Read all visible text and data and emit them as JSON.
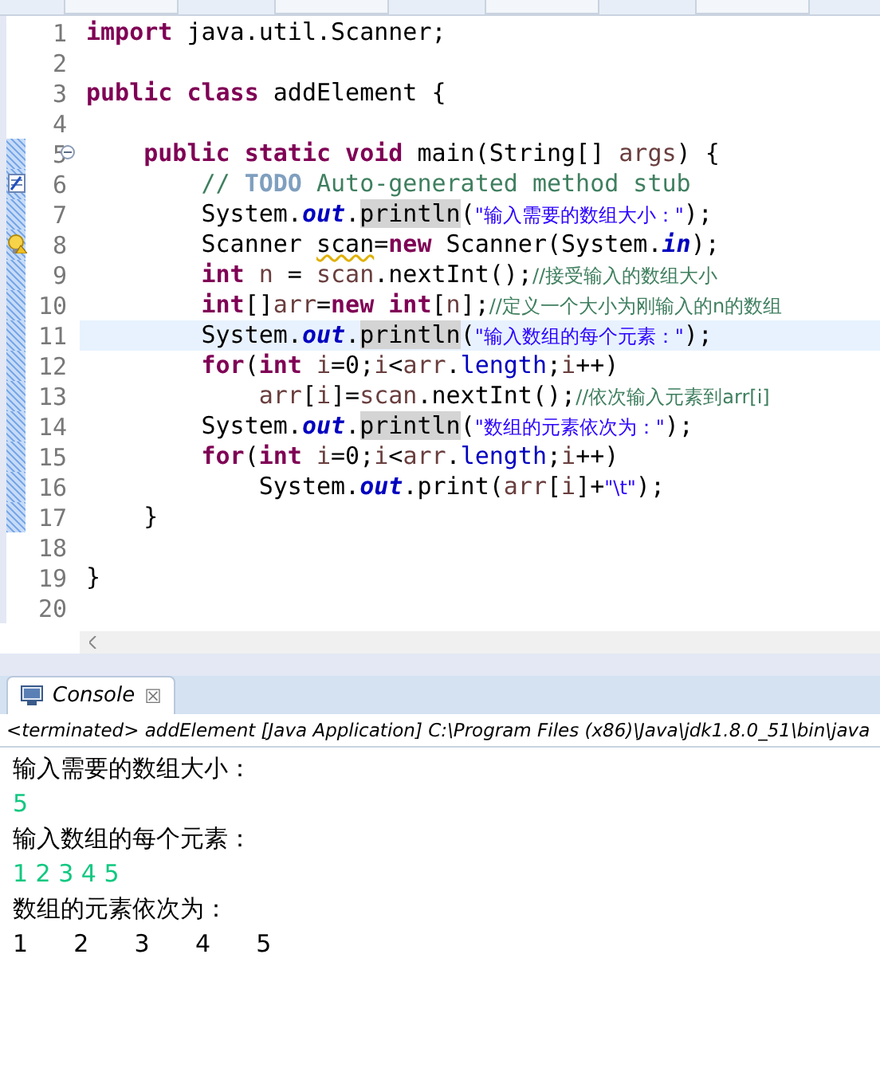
{
  "editor": {
    "lines": [
      {
        "number": "1",
        "changed": false,
        "current": false,
        "tokens": [
          {
            "kind": "kw",
            "text": "import"
          },
          {
            "kind": "plain",
            "text": " java.util.Scanner;"
          }
        ]
      },
      {
        "number": "2",
        "changed": false,
        "current": false
      },
      {
        "number": "3",
        "changed": false,
        "current": false,
        "tokens": [
          {
            "kind": "kw",
            "text": "public class"
          },
          {
            "kind": "plain",
            "text": " addElement {"
          }
        ]
      },
      {
        "number": "4",
        "changed": false,
        "current": false
      },
      {
        "number": "5",
        "changed": true,
        "current": false,
        "collapsible": true,
        "tokens": [
          {
            "kind": "kw",
            "text": "    public static void"
          },
          {
            "kind": "plain",
            "text": " main(String[] "
          },
          {
            "kind": "var",
            "text": "args"
          },
          {
            "kind": "plain",
            "text": ") {"
          }
        ]
      },
      {
        "number": "6",
        "changed": true,
        "current": false,
        "task": true,
        "tokens": [
          {
            "kind": "comment",
            "text": "        // "
          },
          {
            "kind": "todo",
            "text": "TODO"
          },
          {
            "kind": "comment",
            "text": " Auto-generated method stub"
          }
        ]
      },
      {
        "number": "7",
        "changed": true,
        "current": false,
        "tokens": [
          {
            "kind": "plain",
            "text": "        System."
          },
          {
            "kind": "field",
            "text": "out"
          },
          {
            "kind": "plain",
            "text": "."
          },
          {
            "kind": "occurrence",
            "text": "println"
          },
          {
            "kind": "plain",
            "text": "("
          },
          {
            "kind": "str",
            "text": "\"输入需要的数组大小：\""
          },
          {
            "kind": "plain",
            "text": ");"
          }
        ]
      },
      {
        "number": "8",
        "changed": true,
        "current": false,
        "warning": true,
        "tokens": [
          {
            "kind": "plain",
            "text": "        Scanner "
          },
          {
            "kind": "warn",
            "text": "scan"
          },
          {
            "kind": "plain",
            "text": "="
          },
          {
            "kind": "kw",
            "text": "new"
          },
          {
            "kind": "plain",
            "text": " Scanner(System."
          },
          {
            "kind": "field",
            "text": "in"
          },
          {
            "kind": "plain",
            "text": ");"
          }
        ]
      },
      {
        "number": "9",
        "changed": true,
        "current": false,
        "tokens": [
          {
            "kind": "kw",
            "text": "        int"
          },
          {
            "kind": "var",
            "text": " n"
          },
          {
            "kind": "plain",
            "text": " = "
          },
          {
            "kind": "var",
            "text": "scan"
          },
          {
            "kind": "plain",
            "text": ".nextInt();"
          },
          {
            "kind": "comment",
            "text": "//接受输入的数组大小"
          }
        ]
      },
      {
        "number": "10",
        "changed": true,
        "current": false,
        "tokens": [
          {
            "kind": "kw",
            "text": "        int"
          },
          {
            "kind": "plain",
            "text": "[]"
          },
          {
            "kind": "var",
            "text": "arr"
          },
          {
            "kind": "plain",
            "text": "="
          },
          {
            "kind": "kw",
            "text": "new int"
          },
          {
            "kind": "plain",
            "text": "["
          },
          {
            "kind": "var",
            "text": "n"
          },
          {
            "kind": "plain",
            "text": "];"
          },
          {
            "kind": "comment",
            "text": "//定义一个大小为刚输入的n的数组"
          }
        ]
      },
      {
        "number": "11",
        "changed": true,
        "current": true,
        "tokens": [
          {
            "kind": "plain",
            "text": "        System."
          },
          {
            "kind": "field",
            "text": "out"
          },
          {
            "kind": "plain",
            "text": "."
          },
          {
            "kind": "occurrence",
            "text": "println"
          },
          {
            "kind": "plain",
            "text": "("
          },
          {
            "kind": "str",
            "text": "\"输入数组的每个元素：\""
          },
          {
            "kind": "plain",
            "text": ");"
          }
        ]
      },
      {
        "number": "12",
        "changed": true,
        "current": false,
        "tokens": [
          {
            "kind": "kw",
            "text": "        for"
          },
          {
            "kind": "plain",
            "text": "("
          },
          {
            "kind": "kw",
            "text": "int"
          },
          {
            "kind": "var",
            "text": " i"
          },
          {
            "kind": "plain",
            "text": "=0;"
          },
          {
            "kind": "var",
            "text": "i"
          },
          {
            "kind": "plain",
            "text": "<"
          },
          {
            "kind": "var",
            "text": "arr"
          },
          {
            "kind": "plain",
            "text": "."
          },
          {
            "kind": "member",
            "text": "length"
          },
          {
            "kind": "plain",
            "text": ";"
          },
          {
            "kind": "var",
            "text": "i"
          },
          {
            "kind": "plain",
            "text": "++)"
          }
        ]
      },
      {
        "number": "13",
        "changed": true,
        "current": false,
        "tokens": [
          {
            "kind": "var",
            "text": "            arr"
          },
          {
            "kind": "plain",
            "text": "["
          },
          {
            "kind": "var",
            "text": "i"
          },
          {
            "kind": "plain",
            "text": "]="
          },
          {
            "kind": "var",
            "text": "scan"
          },
          {
            "kind": "plain",
            "text": ".nextInt();"
          },
          {
            "kind": "comment",
            "text": "//依次输入元素到arr[i]"
          }
        ]
      },
      {
        "number": "14",
        "changed": true,
        "current": false,
        "tokens": [
          {
            "kind": "plain",
            "text": "        System."
          },
          {
            "kind": "field",
            "text": "out"
          },
          {
            "kind": "plain",
            "text": "."
          },
          {
            "kind": "occurrence",
            "text": "println"
          },
          {
            "kind": "plain",
            "text": "("
          },
          {
            "kind": "str",
            "text": "\"数组的元素依次为：\""
          },
          {
            "kind": "plain",
            "text": ");"
          }
        ]
      },
      {
        "number": "15",
        "changed": true,
        "current": false,
        "tokens": [
          {
            "kind": "kw",
            "text": "        for"
          },
          {
            "kind": "plain",
            "text": "("
          },
          {
            "kind": "kw",
            "text": "int"
          },
          {
            "kind": "var",
            "text": " i"
          },
          {
            "kind": "plain",
            "text": "=0;"
          },
          {
            "kind": "var",
            "text": "i"
          },
          {
            "kind": "plain",
            "text": "<"
          },
          {
            "kind": "var",
            "text": "arr"
          },
          {
            "kind": "plain",
            "text": "."
          },
          {
            "kind": "member",
            "text": "length"
          },
          {
            "kind": "plain",
            "text": ";"
          },
          {
            "kind": "var",
            "text": "i"
          },
          {
            "kind": "plain",
            "text": "++)"
          }
        ]
      },
      {
        "number": "16",
        "changed": true,
        "current": false,
        "tokens": [
          {
            "kind": "plain",
            "text": "            System."
          },
          {
            "kind": "field",
            "text": "out"
          },
          {
            "kind": "plain",
            "text": ".print("
          },
          {
            "kind": "var",
            "text": "arr"
          },
          {
            "kind": "plain",
            "text": "["
          },
          {
            "kind": "var",
            "text": "i"
          },
          {
            "kind": "plain",
            "text": "]+"
          },
          {
            "kind": "str",
            "text": "\"\\t\""
          },
          {
            "kind": "plain",
            "text": ");"
          }
        ]
      },
      {
        "number": "17",
        "changed": true,
        "current": false,
        "tokens": [
          {
            "kind": "plain",
            "text": "    }"
          }
        ]
      },
      {
        "number": "18",
        "changed": false,
        "current": false
      },
      {
        "number": "19",
        "changed": false,
        "current": false,
        "tokens": [
          {
            "kind": "plain",
            "text": "}"
          }
        ]
      },
      {
        "number": "20",
        "changed": false,
        "current": false
      }
    ]
  },
  "console": {
    "tab": {
      "label": "Console",
      "close": "☒"
    },
    "header": "<terminated> addElement [Java Application] C:\\Program Files (x86)\\Java\\jdk1.8.0_51\\bin\\java",
    "lines": [
      {
        "kind": "output",
        "text": "输入需要的数组大小："
      },
      {
        "kind": "input",
        "text": "5"
      },
      {
        "kind": "output",
        "text": "输入数组的每个元素："
      },
      {
        "kind": "input",
        "text": "1 2 3 4 5"
      },
      {
        "kind": "output",
        "text": "数组的元素依次为："
      },
      {
        "kind": "output",
        "text": "1\t2\t3\t4\t5"
      }
    ]
  }
}
